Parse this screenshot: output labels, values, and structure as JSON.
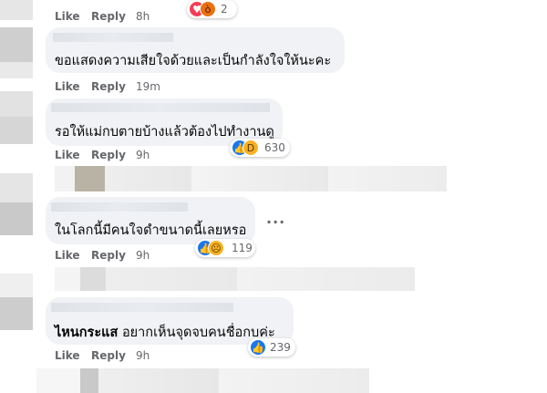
{
  "actions": {
    "like": "Like",
    "reply": "Reply"
  },
  "comments": [
    {
      "text": "",
      "time": "8h",
      "reactions": {
        "count": "2",
        "icons": [
          "love-icon",
          "angry-icon"
        ]
      }
    },
    {
      "text": "ขอแสดงความเสียใจด้วยและเป็นกำลังใจให้นะคะ",
      "time": "19m",
      "reactions": null
    },
    {
      "text": "รอให้แม่กบตายบ้างแล้วต้องไปทำงานดู",
      "time": "9h",
      "reactions": {
        "count": "630",
        "icons": [
          "like-icon",
          "haha-icon"
        ]
      }
    },
    {
      "text": "ในโลกนี้มีคนใจดำขนาดนี้เลยหรอ",
      "time": "9h",
      "reactions": {
        "count": "119",
        "icons": [
          "like-icon",
          "sad-icon"
        ]
      }
    },
    {
      "text": "อยากเห็นจุดจบคนชื่อกบค่ะ",
      "tag": "ไหนกระแส",
      "time": "9h",
      "reactions": {
        "count": "239",
        "icons": [
          "like-icon"
        ]
      }
    }
  ],
  "more_options": "···"
}
